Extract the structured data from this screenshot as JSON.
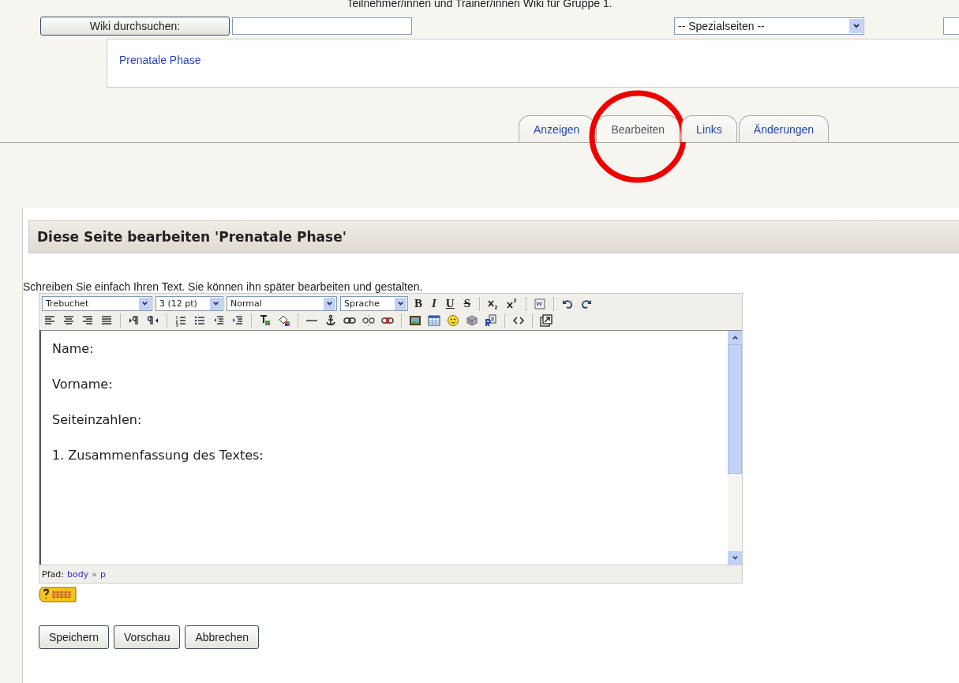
{
  "header": {
    "title": "Teilnehmer/innen und Trainer/innen Wiki für Gruppe 1."
  },
  "search": {
    "button": "Wiki durchsuchen:"
  },
  "special_pages": {
    "value": "-- Spezialseiten --"
  },
  "breadcrumb": {
    "link": "Prenatale Phase"
  },
  "tabs": [
    {
      "label": "Anzeigen",
      "selected": false
    },
    {
      "label": "Bearbeiten",
      "selected": true
    },
    {
      "label": "Links",
      "selected": false
    },
    {
      "label": "Änderungen",
      "selected": false
    }
  ],
  "section": {
    "heading": "Diese Seite bearbeiten 'Prenatale Phase'",
    "instruction": "Schreiben Sie einfach Ihren Text. Sie können ihn später bearbeiten und gestalten."
  },
  "toolbar_rows": [
    [
      {
        "kind": "select",
        "value": "Trebuchet"
      },
      {
        "kind": "select",
        "value": "3 (12 pt)"
      },
      {
        "kind": "select",
        "value": "Normal"
      },
      {
        "kind": "select",
        "value": "Sprache"
      },
      {
        "kind": "bold",
        "label": "B"
      },
      {
        "kind": "italic",
        "label": "I"
      },
      {
        "kind": "underline",
        "label": "U"
      },
      {
        "kind": "strike",
        "label": "S"
      },
      {
        "kind": "sep"
      },
      {
        "kind": "subscript"
      },
      {
        "kind": "superscript"
      },
      {
        "kind": "sep"
      },
      {
        "kind": "wordpaste"
      },
      {
        "kind": "sep"
      },
      {
        "kind": "undo"
      },
      {
        "kind": "redo"
      }
    ],
    [
      {
        "kind": "alignleft"
      },
      {
        "kind": "aligncenter"
      },
      {
        "kind": "alignright"
      },
      {
        "kind": "justify"
      },
      {
        "kind": "sep"
      },
      {
        "kind": "ltr"
      },
      {
        "kind": "rtl"
      },
      {
        "kind": "sep"
      },
      {
        "kind": "orderedlist"
      },
      {
        "kind": "bulletlist"
      },
      {
        "kind": "outdent"
      },
      {
        "kind": "indent"
      },
      {
        "kind": "sep"
      },
      {
        "kind": "textcolor"
      },
      {
        "kind": "bgcolor"
      },
      {
        "kind": "sep"
      },
      {
        "kind": "rule"
      },
      {
        "kind": "anchor"
      },
      {
        "kind": "link"
      },
      {
        "kind": "unlink"
      },
      {
        "kind": "nolink"
      },
      {
        "kind": "sep"
      },
      {
        "kind": "image"
      },
      {
        "kind": "table"
      },
      {
        "kind": "smiley"
      },
      {
        "kind": "charmap"
      },
      {
        "kind": "replace"
      },
      {
        "kind": "sep"
      },
      {
        "kind": "source"
      },
      {
        "kind": "sep"
      },
      {
        "kind": "fullscreen"
      }
    ]
  ],
  "editor": {
    "lines": [
      "Name:",
      "Vorname:",
      "Seiteinzahlen:",
      "1. Zusammenfassung des Textes:"
    ]
  },
  "path_bar": {
    "label": "Pfad:",
    "items": [
      "body",
      "p"
    ],
    "separator": "»"
  },
  "buttons": [
    "Speichern",
    "Vorschau",
    "Abbrechen"
  ]
}
